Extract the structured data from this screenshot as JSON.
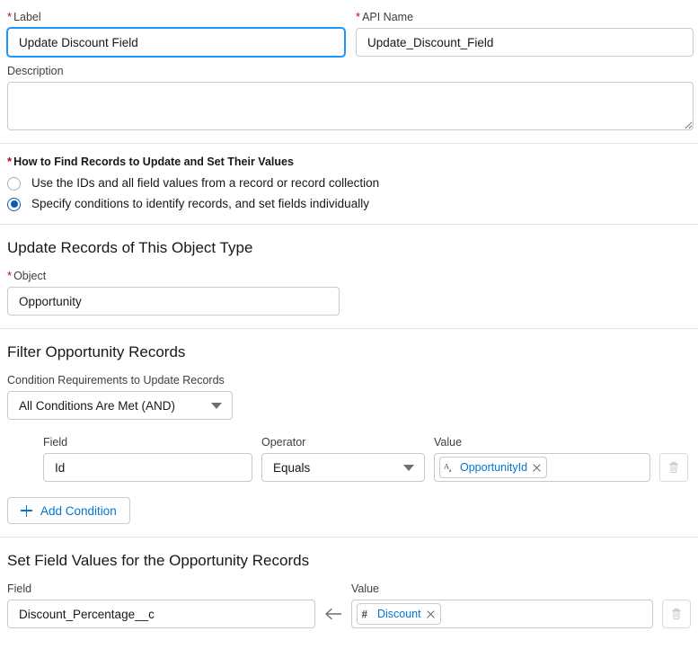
{
  "form": {
    "label": {
      "label_text": "Label",
      "required": true,
      "value": "Update Discount Field",
      "focused": true
    },
    "api_name": {
      "label_text": "API Name",
      "required": true,
      "value": "Update_Discount_Field"
    },
    "description": {
      "label_text": "Description",
      "value": "",
      "placeholder": ""
    },
    "how_to_find": {
      "legend": "How to Find Records to Update and Set Their Values",
      "required": true,
      "options": [
        {
          "label": "Use the IDs and all field values from a record or record collection",
          "selected": false
        },
        {
          "label": "Specify conditions to identify records, and set fields individually",
          "selected": true
        }
      ]
    }
  },
  "object_section": {
    "heading": "Update Records of This Object Type",
    "object_field": {
      "label_text": "Object",
      "required": true,
      "value": "Opportunity"
    }
  },
  "filter_section": {
    "heading": "Filter Opportunity Records",
    "condition_requirements": {
      "label_text": "Condition Requirements to Update Records",
      "value": "All Conditions Are Met (AND)",
      "icon": "chevron-down-icon"
    },
    "column_headers": {
      "field": "Field",
      "operator": "Operator",
      "value": "Value"
    },
    "conditions": [
      {
        "field": "Id",
        "operator": "Equals",
        "value_pill": {
          "text": "OpportunityId",
          "type_icon": "text-type-icon",
          "remove_icon": "close-icon"
        },
        "delete_icon": "trash-icon",
        "delete_disabled": true
      }
    ],
    "add_condition_button": {
      "label": "Add Condition",
      "icon": "plus-icon"
    }
  },
  "set_values_section": {
    "heading": "Set Field Values for the Opportunity Records",
    "column_headers": {
      "field": "Field",
      "value": "Value"
    },
    "assignments": [
      {
        "field": "Discount_Percentage__c",
        "arrow_icon": "arrow-left-icon",
        "value_pill": {
          "text": "Discount",
          "type_icon": "number-type-icon",
          "remove_icon": "close-icon"
        },
        "delete_icon": "trash-icon",
        "delete_disabled": true
      }
    ]
  },
  "colors": {
    "accent_blue": "#0176d3",
    "focus_blue": "#1b96ff",
    "required_red": "#ba0517",
    "radio_selected": "#0b5cab",
    "border_grey": "#c9c9c9",
    "divider_grey": "#e5e5e5",
    "text_dark": "#181818",
    "label_grey": "#3e3e3c",
    "icon_grey": "#706e6b"
  }
}
